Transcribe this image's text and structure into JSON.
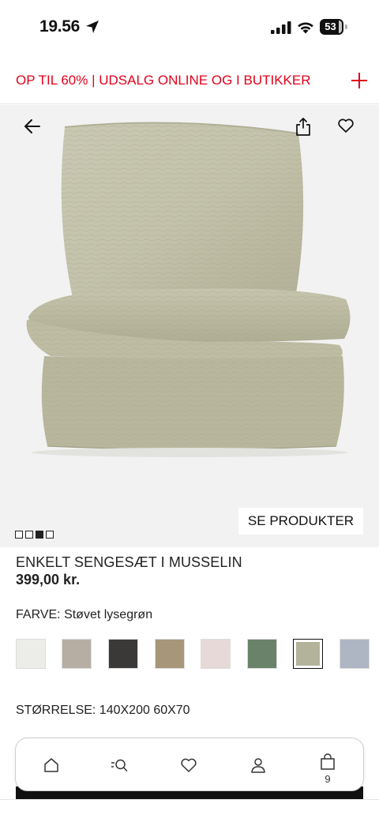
{
  "status_bar": {
    "time": "19.56",
    "battery": "53"
  },
  "promo": {
    "text": "OP TIL 60% | UDSALG ONLINE OG I BUTIKKER",
    "color": "#e2001a",
    "expand_icon": "plus-icon"
  },
  "hero": {
    "icons": [
      "back-arrow-icon",
      "share-icon",
      "heart-icon"
    ],
    "see_products_label": "SE PRODUKTER",
    "image_count": 4,
    "active_image": 3
  },
  "product": {
    "name": "ENKELT SENGESÆT I MUSSELIN",
    "price": "399,00 kr.",
    "color_label": "FARVE: Støvet lysegrøn",
    "size_label": "STØRRELSE: 140X200 60X70",
    "swatches": [
      {
        "color": "#ecece8",
        "selected": false
      },
      {
        "color": "#b7aea3",
        "selected": false
      },
      {
        "color": "#3b3838",
        "selected": false
      },
      {
        "color": "#a8967b",
        "selected": false
      },
      {
        "color": "#e8d9d9",
        "selected": false
      },
      {
        "color": "#6a816a",
        "selected": false
      },
      {
        "color": "#b3b39b",
        "selected": true
      },
      {
        "color": "#aeb6c3",
        "selected": false
      }
    ]
  },
  "bottom_nav": {
    "items": [
      "home-icon",
      "search-icon",
      "heart-icon",
      "account-icon",
      "bag-icon"
    ],
    "bag_count": "9"
  }
}
